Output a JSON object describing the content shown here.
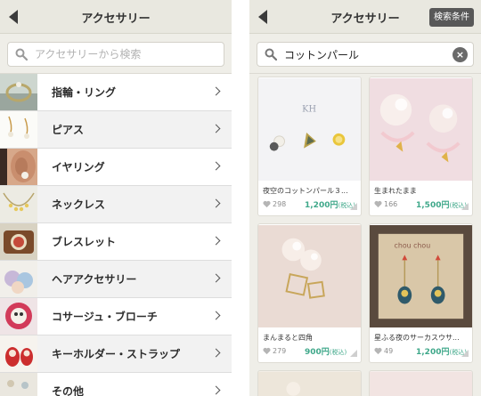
{
  "left": {
    "nav": {
      "title": "アクセサリー"
    },
    "search": {
      "placeholder": "アクセサリーから検索"
    },
    "categories": [
      {
        "label": "指輪・リング"
      },
      {
        "label": "ピアス"
      },
      {
        "label": "イヤリング"
      },
      {
        "label": "ネックレス"
      },
      {
        "label": "ブレスレット"
      },
      {
        "label": "ヘアアクセサリー"
      },
      {
        "label": "コサージュ・ブローチ"
      },
      {
        "label": "キーホルダー・ストラップ"
      },
      {
        "label": "その他"
      }
    ]
  },
  "right": {
    "nav": {
      "title": "アクセサリー",
      "filter_label": "検索条件"
    },
    "search": {
      "value": "コットンパール",
      "clear_icon": "×"
    },
    "products": [
      {
        "title": "夜空のコットンパール３...",
        "likes": "298",
        "price": "1,200円",
        "tax": "(税込)",
        "image_text": "KH"
      },
      {
        "title": "生まれたまま",
        "likes": "166",
        "price": "1,500円",
        "tax": "(税込)"
      },
      {
        "title": "まんまると四角",
        "likes": "279",
        "price": "900円",
        "tax": "(税込)"
      },
      {
        "title": "星ふる夜のサーカスウサ...",
        "likes": "49",
        "price": "1,200円",
        "tax": "(税込)",
        "image_text": "chou chou"
      }
    ]
  },
  "colors": {
    "price": "#3fa88a",
    "navbar": "#e9e8e0",
    "filter_button": "#585858"
  }
}
